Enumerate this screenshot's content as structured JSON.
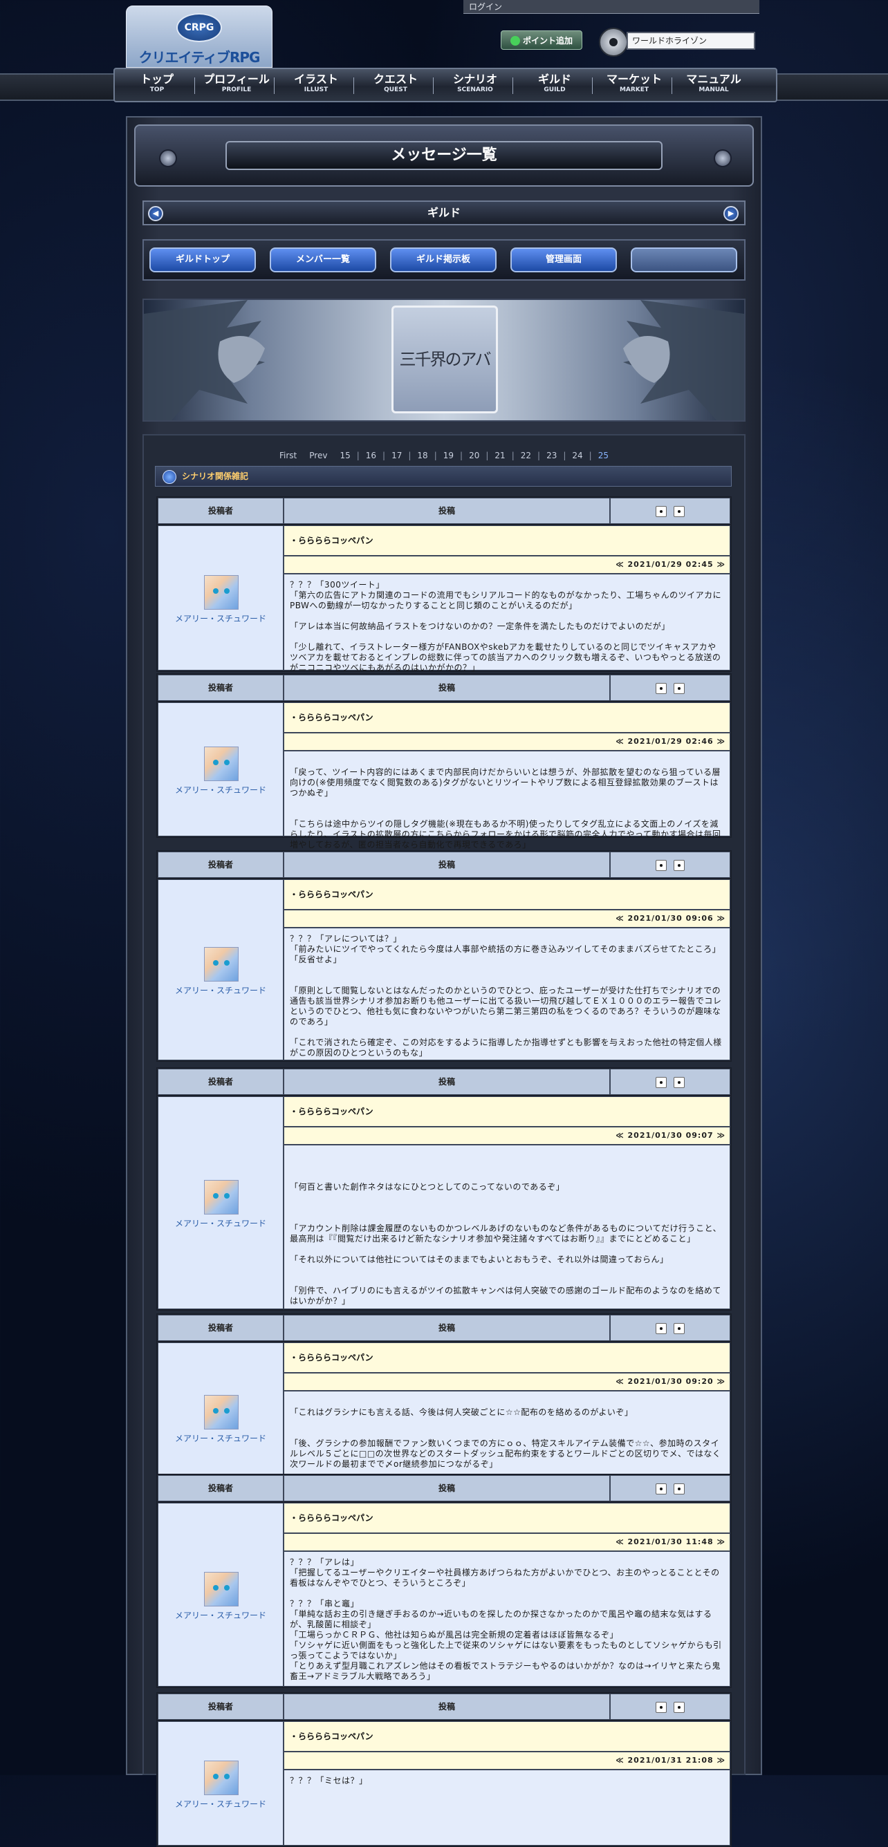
{
  "header": {
    "logo_badge": "CRPG",
    "logo_text": "クリエイティブRPG",
    "login": "ログイン",
    "point_button": "ポイント追加",
    "world_select": "ワールドホライゾン"
  },
  "nav": [
    {
      "jp": "トップ",
      "en": "TOP"
    },
    {
      "jp": "プロフィール",
      "en": "PROFILE"
    },
    {
      "jp": "イラスト",
      "en": "ILLUST"
    },
    {
      "jp": "クエスト",
      "en": "QUEST"
    },
    {
      "jp": "シナリオ",
      "en": "SCENARIO"
    },
    {
      "jp": "ギルド",
      "en": "GUILD"
    },
    {
      "jp": "マーケット",
      "en": "MARKET"
    },
    {
      "jp": "マニュアル",
      "en": "MANUAL"
    }
  ],
  "page_title": "メッセージ一覧",
  "guild_bar": "ギルド",
  "tabs": [
    "ギルドトップ",
    "メンバー一覧",
    "ギルド掲示板",
    "管理画面",
    ""
  ],
  "banner_logo": "三千界のアバター",
  "pager": {
    "first": "First",
    "prev": "Prev",
    "pages": [
      "15",
      "16",
      "17",
      "18",
      "19",
      "20",
      "21",
      "22",
      "23",
      "24",
      "25"
    ],
    "current": "25"
  },
  "category": "シナリオ関係雑記",
  "table_headers": {
    "author": "投稿者",
    "post": "投稿"
  },
  "posts": [
    {
      "author": "メアリー・スチュワード",
      "subject": "・ららららコッペパン",
      "date": "≪ 2021/01/29 02:45 ≫",
      "body": "？？？「300ツイート」\n「第六の広告にアトカ関連のコードの流用でもシリアルコード的なものがなかったり、工場ちゃんのツイアカにPBWへの動線が一切なかったりすることと同じ類のことがいえるのだが」\n\n「アレは本当に何故納品イラストをつけないのかの？一定条件を満たしたものだけでよいのだが」\n\n「少し離れて、イラストレーター様方がFANBOXやskebアカを載せたりしているのと同じでツイキャスアカやツベアカを載せておるとインプレの総数に伴っての該当アカへのクリック数も増えるぞ、いつもやっとる放送のがニコニコやツベにもあがるのはいかがかの？」"
    },
    {
      "author": "メアリー・スチュワード",
      "subject": "・ららららコッペパン",
      "date": "≪ 2021/01/29 02:46 ≫",
      "body": "\n「戻って、ツイート内容的にはあくまで内部民向けだからいいとは想うが、外部拡散を望むのなら狙っている層向けの(※使用頻度でなく閲覧数のある)タグがないとリツイートやリプ数による相互登録拡散効果のブーストはつかぬぞ」\n\n\n「こちらは途中からツイの隠しタグ機能(※現在もあるか不明)使ったりしてタグ乱立による文面上のノイズを減らしたり、イラストの拡散層の方にこちらからフォローをかける形で脳筋の完全人力でやって動かす場合は毎回増やしておるが、匿の担当者なら自動化で再現できるであろ」"
    },
    {
      "author": "メアリー・スチュワード",
      "subject": "・ららららコッペパン",
      "date": "≪ 2021/01/30 09:06 ≫",
      "body": "？？？「アレについては？」\n「前みたいにツイでやってくれたら今度は人事部や統括の方に巻き込みツイしてそのままバズらせてたところ」\n「反省せよ」\n\n\n「原則として閲覧しないとはなんだったのかというのでひとつ、庇ったユーザーが受けた仕打ちでシナリオでの通告も該当世界シナリオ参加お断りも他ユーザーに出てる扱い一切飛び越してＥＸ１０００のエラー報告でコレというのでひとつ、他社も気に食わないやつがいたら第二第三第四の私をつくるのであろ？そういうのが趣味なのであろ」\n\n「これで消されたら確定ぞ、この対応をするように指導したか指導せずとも影響を与えおった他社の特定個人様がこの原因のひとつというのもな」"
    },
    {
      "author": "メアリー・スチュワード",
      "subject": "・ららららコッペパン",
      "date": "≪ 2021/01/30 09:07 ≫",
      "body": "\n\n\n「何百と書いた創作ネタはなにひとつとしてのこってないのであるぞ」\n\n\n\n「アカウント削除は課金履歴のないものかつレベルあげのないものなど条件があるものについてだけ行うこと、最高刑は『『閲覧だけ出来るけど新たなシナリオ参加や発注諸々すべてはお断り』』までにとどめること」\n\n「それ以外については他社についてはそのままでもよいとおもうぞ、それ以外は間違っておらん」\n\n\n「別件で、ハイブリのにも言えるがツイの拡散キャンペは何人突破での感謝のゴールド配布のようなのを絡めてはいかがか？」"
    },
    {
      "author": "メアリー・スチュワード",
      "subject": "・ららららコッペパン",
      "date": "≪ 2021/01/30 09:20 ≫",
      "body": "\n「これはグラシナにも言える話、今後は何人突破ごとに☆☆配布のを絡めるのがよいぞ」\n\n\n「後、グラシナの参加報酬でファン数いくつまでの方にｏｏ、特定スキルアイテム装備で☆☆、参加時のスタイルレベル５ごとに□□の次世界などのスタートダッシュ配布約束をするとワールドごとの区切りでメ、ではなく次ワールドの最初までで〆or継続参加につながるぞ」"
    },
    {
      "author": "メアリー・スチュワード",
      "subject": "・ららららコッペパン",
      "date": "≪ 2021/01/30 11:48 ≫",
      "body": "？？？「アレは」\n「把握してるユーザーやクリエイターや社員様方あげつらねた方がよいかでひとつ、お主のやっとることとその看板はなんぞやでひとつ、そういうところぞ」\n\n？？？「串と竈」\n「単純な話お主の引き継ぎ手おるのか→近いものを探したのか探さなかったのかで風呂や竈の結末な気はするが、乳酸菌に相談ぞ」\n「工場らっかＣＲＰＧ、他社は知らぬが風呂は完全新規の定着者はほぼ皆無なるぞ」\n「ソシャゲに近い側面をもっと強化した上で従来のソシャゲにはない要素をもったものとしてソシャゲからも引っ張ってこようではないか」\n「とりあえず型月職これアズレン他はその看板でストラテジーもやるのはいかがか？なのは→イリヤと来たら鬼畜王→アドミラブル大戦略であろう」"
    },
    {
      "author": "メアリー・スチュワード",
      "subject": "・ららららコッペパン",
      "date": "≪ 2021/01/31 21:08 ≫",
      "body": "？？？「ミセは？」"
    }
  ]
}
